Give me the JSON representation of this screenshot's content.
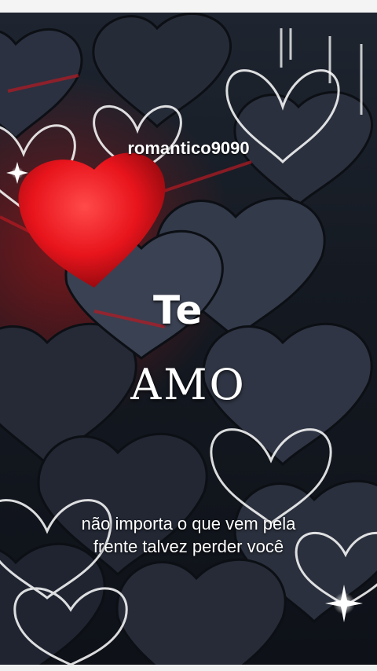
{
  "overlay": {
    "username": "romantico9090",
    "title_word_1": "Te",
    "title_word_2": "AMO",
    "caption_line_1": "não importa o que vem pela",
    "caption_line_2": "frente talvez perder você"
  },
  "colors": {
    "accent_heart": "#e8141c",
    "background": "#151a22",
    "outline_heart": "#ffffff"
  }
}
